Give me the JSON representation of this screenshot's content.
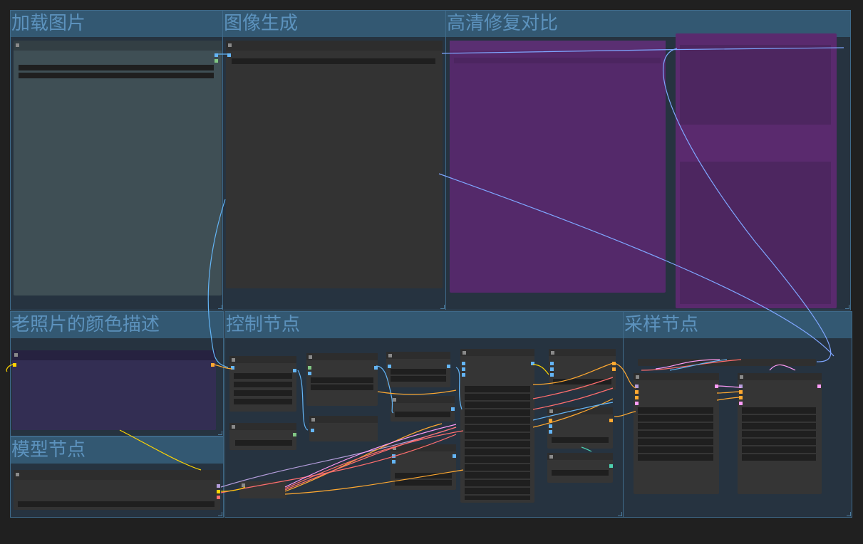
{
  "groups": {
    "load_image": {
      "title": "加载图片"
    },
    "image_gen": {
      "title": "图像生成"
    },
    "hires_compare": {
      "title": "高清修复对比"
    },
    "color_desc": {
      "title": "老照片的颜色描述"
    },
    "control_nodes": {
      "title": "控制节点"
    },
    "sampler_nodes": {
      "title": "采样节点"
    },
    "model_nodes": {
      "title": "模型节点"
    }
  },
  "colors": {
    "background": "#202020",
    "group_body": "#263340",
    "group_header": "#335872",
    "group_title": "#5c92bd",
    "node_body": "#353535",
    "widget": "#1f1f1f",
    "purple_node": "#54296a",
    "note_node": "#332e53",
    "image_node": "#3f4f55"
  },
  "icons": {
    "collapse": "node-collapse-icon",
    "port": "port-dot-icon",
    "resize": "group-resize-handle-icon"
  }
}
